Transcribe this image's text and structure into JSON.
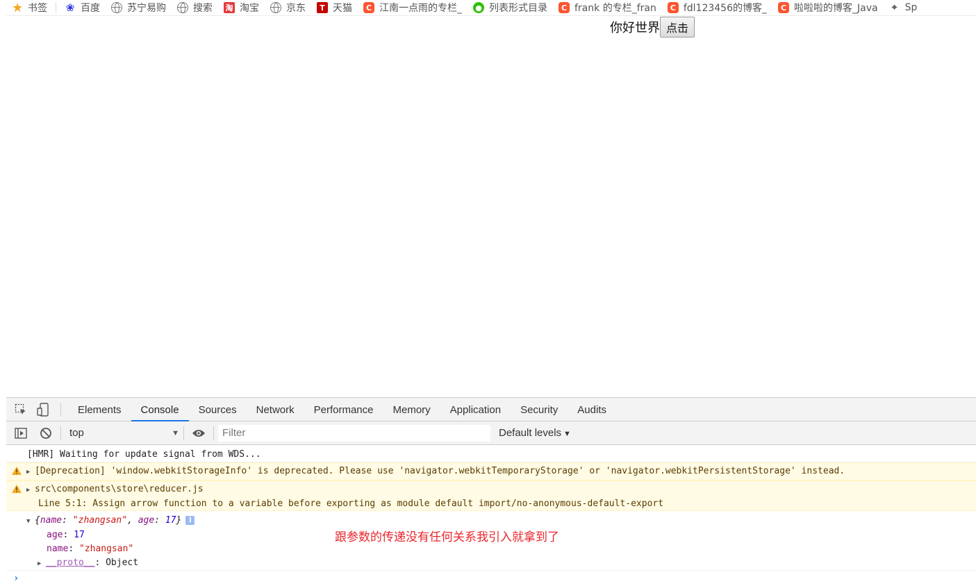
{
  "bookmarks": [
    {
      "icon": "star-icon",
      "label": "书签"
    },
    {
      "icon": "baidu-icon",
      "label": "百度"
    },
    {
      "icon": "globe-icon",
      "label": "苏宁易购"
    },
    {
      "icon": "globe-icon",
      "label": "搜索"
    },
    {
      "icon": "taobao-icon",
      "label": "淘宝"
    },
    {
      "icon": "globe-icon",
      "label": "京东"
    },
    {
      "icon": "tmall-icon",
      "label": "天猫"
    },
    {
      "icon": "csdn-icon",
      "label": "江南一点雨的专栏_"
    },
    {
      "icon": "wechat-icon",
      "label": "列表形式目录"
    },
    {
      "icon": "csdn-icon",
      "label": "frank 的专栏_fran"
    },
    {
      "icon": "csdn-icon",
      "label": "fdl123456的博客_"
    },
    {
      "icon": "csdn-icon",
      "label": "啦啦啦的博客_Java"
    },
    {
      "icon": "spring-icon",
      "label": "Sp"
    }
  ],
  "page": {
    "hello_text": "你好世界",
    "click_button_label": "点击"
  },
  "devtools": {
    "tabs": [
      "Elements",
      "Console",
      "Sources",
      "Network",
      "Performance",
      "Memory",
      "Application",
      "Security",
      "Audits"
    ],
    "active_tab": "Console",
    "context": "top",
    "filter_placeholder": "Filter",
    "levels_label": "Default levels",
    "messages": {
      "hmr": "[HMR] Waiting for update signal from WDS...",
      "deprecation": "[Deprecation] 'window.webkitStorageInfo' is deprecated. Please use 'navigator.webkitTemporaryStorage' or 'navigator.webkitPersistentStorage' instead.",
      "lint_file": "src\\components\\store\\reducer.js",
      "lint_detail": "Line 5:1:  Assign arrow function to a variable before exporting as module default  import/no-anonymous-default-export",
      "object": {
        "summary_open": "{",
        "summary_name_key": "name",
        "summary_name_val": "\"zhangsan\"",
        "summary_age_key": "age",
        "summary_age_val": "17",
        "summary_close": "}",
        "age_key": "age",
        "age_val": "17",
        "name_key": "name",
        "name_val": "\"zhangsan\"",
        "proto_key": "__proto__",
        "proto_val": "Object"
      }
    },
    "annotation": "跟参数的传递没有任何关系我引入就拿到了",
    "prompt_symbol": "›"
  },
  "colors": {
    "active_tab_underline": "#1a73e8",
    "warning_bg": "#fffbe5",
    "annotation": "#e8262d"
  }
}
